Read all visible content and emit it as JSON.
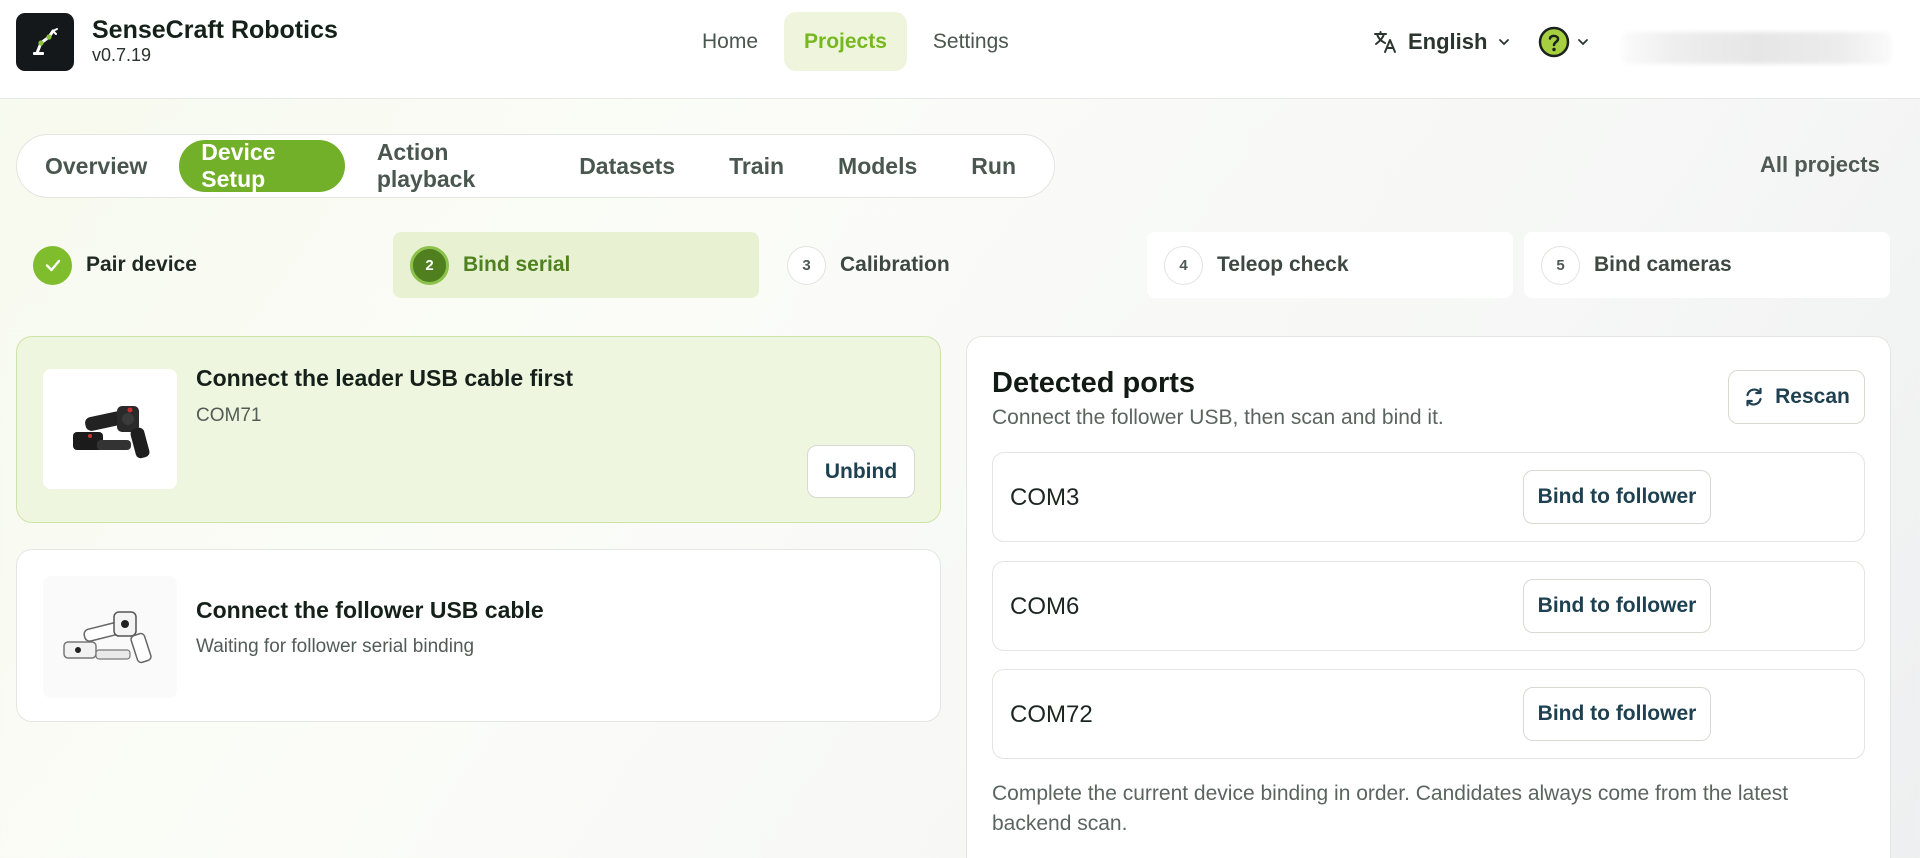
{
  "app": {
    "name": "SenseCraft Robotics",
    "version": "v0.7.19"
  },
  "topnav": {
    "items": [
      {
        "label": "Home",
        "active": false
      },
      {
        "label": "Projects",
        "active": true
      },
      {
        "label": "Settings",
        "active": false
      }
    ],
    "language": "English"
  },
  "colors": {
    "accent": "#73b02a",
    "accent_text": "#76b81f",
    "active_bg": "#eef5dc"
  },
  "tabs": [
    {
      "label": "Overview",
      "active": false
    },
    {
      "label": "Device Setup",
      "active": true
    },
    {
      "label": "Action playback",
      "active": false
    },
    {
      "label": "Datasets",
      "active": false
    },
    {
      "label": "Train",
      "active": false
    },
    {
      "label": "Models",
      "active": false
    },
    {
      "label": "Run",
      "active": false
    }
  ],
  "all_projects": "All projects",
  "steps": [
    {
      "num": "",
      "label": "Pair device",
      "state": "done"
    },
    {
      "num": "2",
      "label": "Bind serial",
      "state": "active"
    },
    {
      "num": "3",
      "label": "Calibration",
      "state": "pending"
    },
    {
      "num": "4",
      "label": "Teleop check",
      "state": "pending"
    },
    {
      "num": "5",
      "label": "Bind cameras",
      "state": "pending"
    }
  ],
  "leader": {
    "title": "Connect the leader USB cable first",
    "port": "COM71",
    "unbind_label": "Unbind"
  },
  "follower": {
    "title": "Connect the follower USB cable",
    "status": "Waiting for follower serial binding"
  },
  "ports": {
    "title": "Detected ports",
    "subtitle": "Connect the follower USB, then scan and bind it.",
    "rescan_label": "Rescan",
    "items": [
      {
        "name": "COM3",
        "action": "Bind to follower"
      },
      {
        "name": "COM6",
        "action": "Bind to follower"
      },
      {
        "name": "COM72",
        "action": "Bind to follower"
      }
    ],
    "note": "Complete the current device binding in order. Candidates always come from the latest backend scan."
  }
}
